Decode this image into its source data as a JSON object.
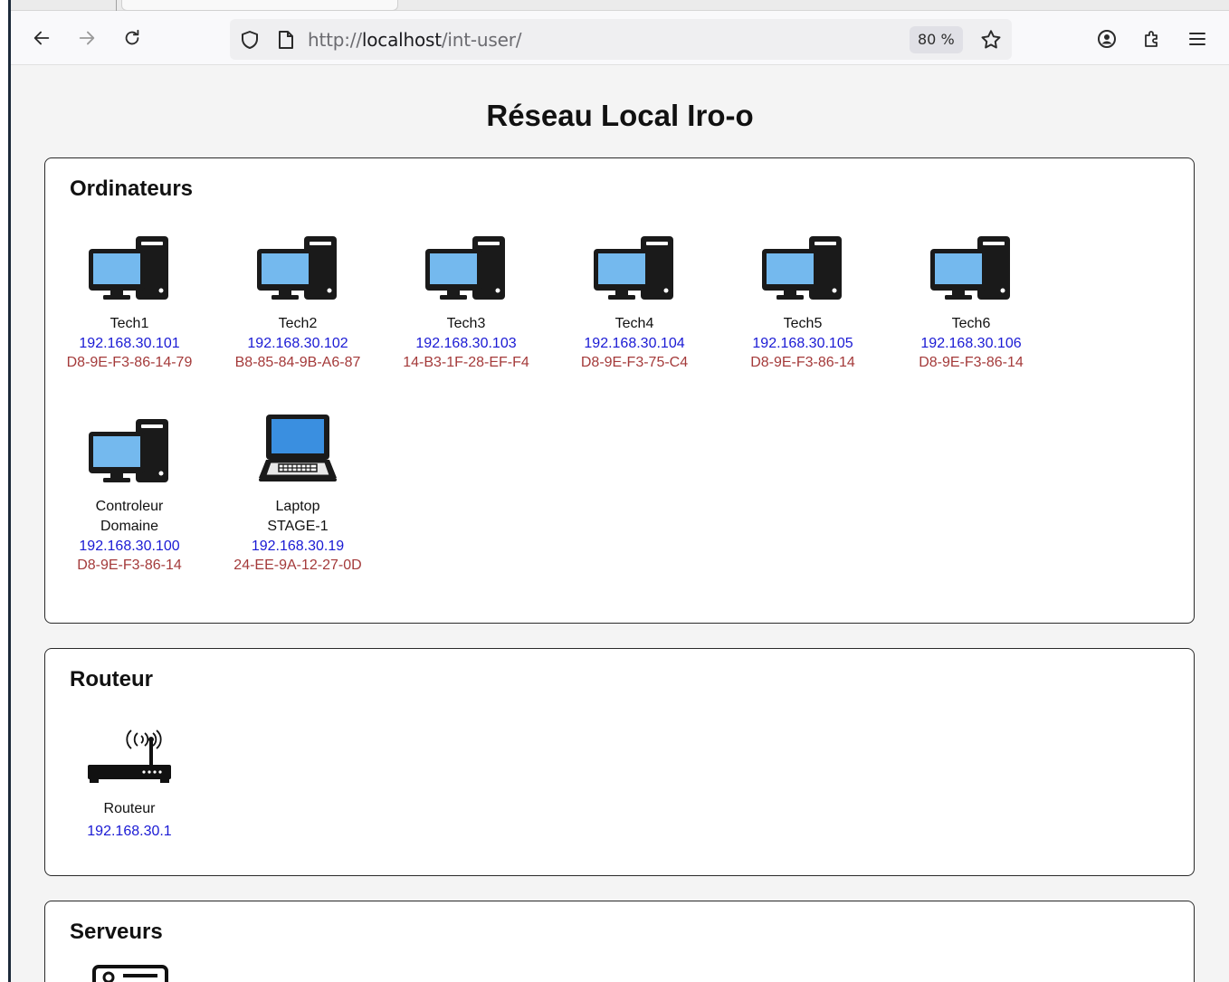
{
  "browser": {
    "url_scheme": "http://",
    "url_host": "localhost",
    "url_path": "/int-user/",
    "zoom": "80 %"
  },
  "page": {
    "title": "Réseau Local Iro-o"
  },
  "sections": {
    "computers": {
      "title": "Ordinateurs",
      "devices": [
        {
          "name": "Tech1",
          "ip": "192.168.30.101",
          "mac": "D8-9E-F3-86-14-79",
          "icon": "desktop-computer-icon"
        },
        {
          "name": "Tech2",
          "ip": "192.168.30.102",
          "mac": "B8-85-84-9B-A6-87",
          "icon": "desktop-computer-icon"
        },
        {
          "name": "Tech3",
          "ip": "192.168.30.103",
          "mac": "14-B3-1F-28-EF-F4",
          "icon": "desktop-computer-icon"
        },
        {
          "name": "Tech4",
          "ip": "192.168.30.104",
          "mac": "D8-9E-F3-75-C4",
          "icon": "desktop-computer-icon"
        },
        {
          "name": "Tech5",
          "ip": "192.168.30.105",
          "mac": "D8-9E-F3-86-14",
          "icon": "desktop-computer-icon"
        },
        {
          "name": "Tech6",
          "ip": "192.168.30.106",
          "mac": "D8-9E-F3-86-14",
          "icon": "desktop-computer-icon"
        },
        {
          "name_line1": "Controleur",
          "name_line2": "Domaine",
          "ip": "192.168.30.100",
          "mac": "D8-9E-F3-86-14",
          "icon": "desktop-computer-icon"
        },
        {
          "name_line1": "Laptop",
          "name_line2": "STAGE-1",
          "ip": "192.168.30.19",
          "mac": "24-EE-9A-12-27-0D",
          "icon": "laptop-icon"
        }
      ]
    },
    "router": {
      "title": "Routeur",
      "devices": [
        {
          "name": "Routeur",
          "ip": "192.168.30.1",
          "icon": "router-icon"
        }
      ]
    },
    "servers": {
      "title": "Serveurs",
      "icon": "server-icon"
    }
  },
  "colors": {
    "ip": "#1a1ad4",
    "mac": "#a43a3a",
    "screen": "#74b9ee",
    "laptop_screen": "#3a8fe0"
  }
}
